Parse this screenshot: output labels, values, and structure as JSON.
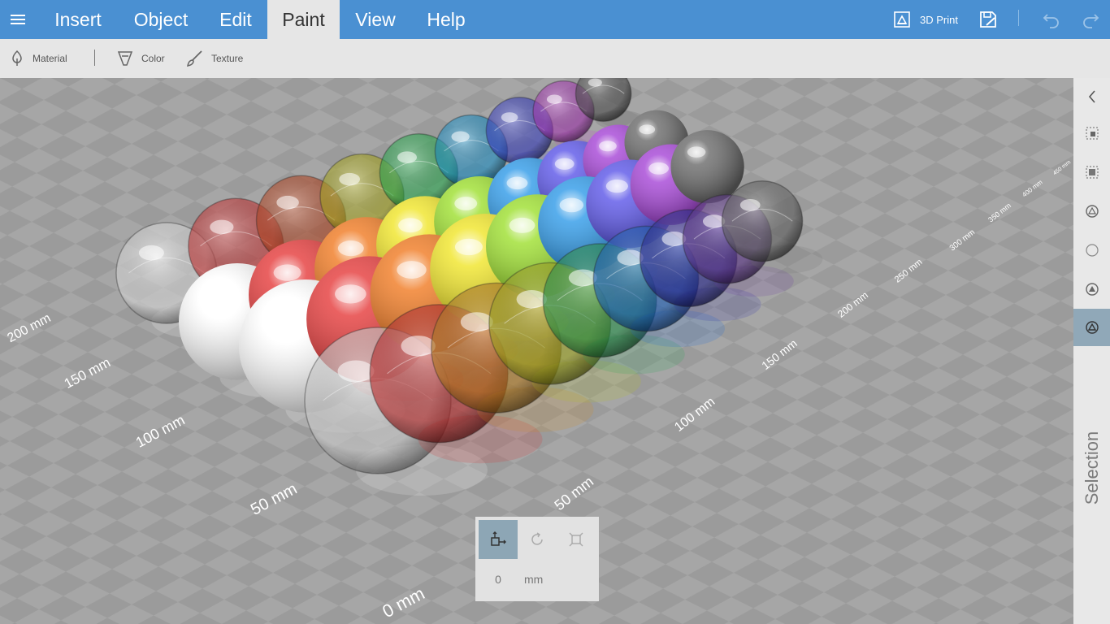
{
  "menu": {
    "tabs": [
      {
        "label": "Insert"
      },
      {
        "label": "Object"
      },
      {
        "label": "Edit"
      },
      {
        "label": "Paint",
        "active": true
      },
      {
        "label": "View"
      },
      {
        "label": "Help"
      }
    ],
    "print_label": "3D Print",
    "icons": [
      "hamburger-icon",
      "print-3d-icon",
      "save-icon",
      "undo-icon",
      "redo-icon"
    ]
  },
  "toolbar": {
    "material_label": "Material",
    "color_label": "Color",
    "texture_label": "Texture"
  },
  "viewport": {
    "grid_labels": {
      "left": [
        "200 mm",
        "150 mm",
        "100 mm",
        "50 mm",
        "0 mm"
      ],
      "right": [
        "450 mm",
        "400 mm",
        "350 mm",
        "300 mm",
        "250 mm",
        "200 mm",
        "150 mm",
        "100 mm",
        "50 mm"
      ]
    },
    "sphere_rows": [
      {
        "material": "glass",
        "colors": [
          "#ffffff",
          "#e53a3a",
          "#d04c22",
          "#c4c221",
          "#2dc45a",
          "#1ea6e6",
          "#3e45e0",
          "#c03ed0",
          "#555555"
        ]
      },
      {
        "material": "matte",
        "colors": [
          "#ffffff",
          "#e53a3a",
          "#f07a22",
          "#f0e528",
          "#9ddf2e",
          "#2f9ae8",
          "#5b55e8",
          "#a544d6",
          "#6a6a6a"
        ]
      },
      {
        "material": "gloss",
        "colors": [
          "#ffffff",
          "#e53a3a",
          "#f07a22",
          "#f0e528",
          "#9ddf2e",
          "#2f9ae8",
          "#5b55e8",
          "#a544d6",
          "#6a6a6a"
        ]
      },
      {
        "material": "clear-glass",
        "colors": [
          "#f2f2f2",
          "#d82a2a",
          "#d08a1e",
          "#b8c01e",
          "#26a852",
          "#1a6cd8",
          "#2a2aa8",
          "#6a3aa0",
          "#707070"
        ]
      }
    ]
  },
  "right_panel": {
    "selection_label": "Selection",
    "icons": [
      "chevron-left-icon",
      "select-all-icon",
      "select-region-icon",
      "magic-select-icon",
      "circle-icon",
      "shape-select-icon",
      "selection-mode-icon"
    ]
  },
  "transform": {
    "value": "0",
    "unit": "mm",
    "active_tool": "move",
    "icons": [
      "move-icon",
      "rotate-icon",
      "scale-icon"
    ]
  },
  "colors": {
    "menu_bar": "#4a90d2",
    "toolbar": "#e6e6e6",
    "active_tab": "#e6e6e6",
    "viewport": "#a3a3a3",
    "active_tool": "#8da6b5"
  }
}
